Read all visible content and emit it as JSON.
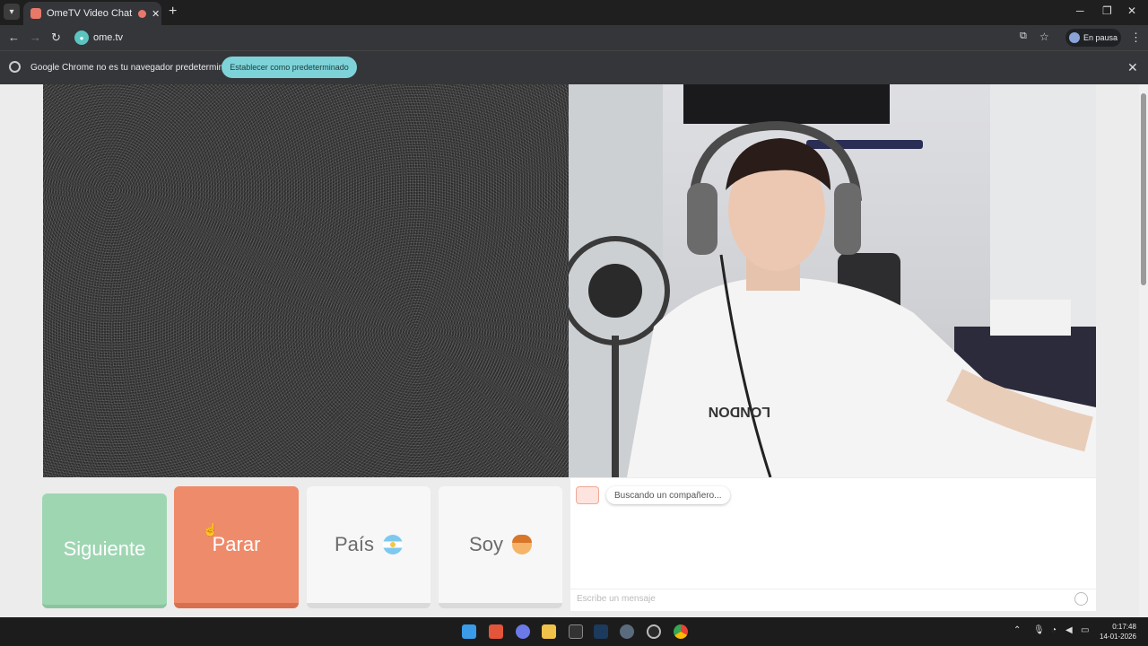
{
  "browser": {
    "tab_title": "OmeTV Video Chat — Ome",
    "tab_close": "✕",
    "new_tab": "+",
    "url": "ome.tv",
    "profile_label": "En pausa",
    "infobar_text": "Google Chrome no es tu navegador predeterminado",
    "infobar_button": "Establecer como predeterminado"
  },
  "controls": {
    "next_label": "Siguiente",
    "stop_label": "Parar",
    "country_label": "País",
    "gender_label": "Soy"
  },
  "chat": {
    "status_message": "Buscando un compañero...",
    "input_placeholder": "Escribe un mensaje"
  },
  "remote_video": {
    "shirt_text": "LONDON"
  },
  "taskbar": {
    "time": "0:17:48",
    "date": "14-01-2026"
  },
  "colors": {
    "next_button": "#9ed6b2",
    "stop_button": "#ee8b6a",
    "infobar_button": "#7dd3d8"
  }
}
